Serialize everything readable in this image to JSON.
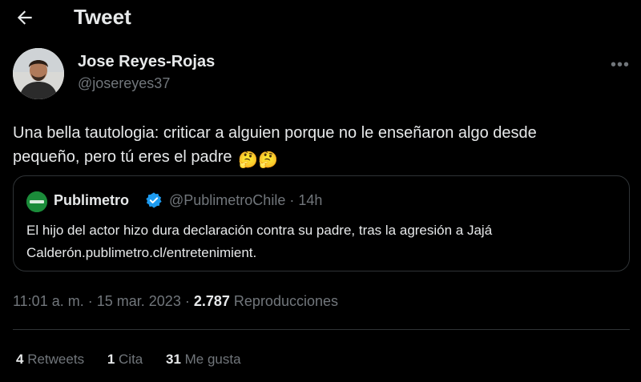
{
  "header": {
    "title": "Tweet",
    "back_icon": "arrow-left-icon"
  },
  "author": {
    "name": "Jose Reyes-Rojas",
    "handle": "@josereyes37"
  },
  "tweet": {
    "text": "Una bella tautologia: criticar a alguien porque no le enseñaron algo desde pequeño, pero tú eres el padre",
    "emoji": "🤔🤔"
  },
  "quoted": {
    "name": "Publimetro",
    "handle": "@PublimetroChile",
    "separator": "·",
    "time": "14h",
    "text": "El hijo del actor hizo dura declaración contra su padre, tras la agresión a Jajá Calderón.publimetro.cl/entretenimient."
  },
  "meta": {
    "time": "11:01 a. m.",
    "separator": "·",
    "date": "15 mar. 2023",
    "views_count": "2.787",
    "views_label": "Reproducciones"
  },
  "stats": {
    "retweets_count": "4",
    "retweets_label": "Retweets",
    "quotes_count": "1",
    "quotes_label": "Cita",
    "likes_count": "31",
    "likes_label": "Me gusta"
  },
  "colors": {
    "background": "#000000",
    "text": "#e7e9ea",
    "muted": "#71767b",
    "border": "#2f3336",
    "verified": "#1d9bf0",
    "publimetro_green": "#1b8c3a"
  }
}
